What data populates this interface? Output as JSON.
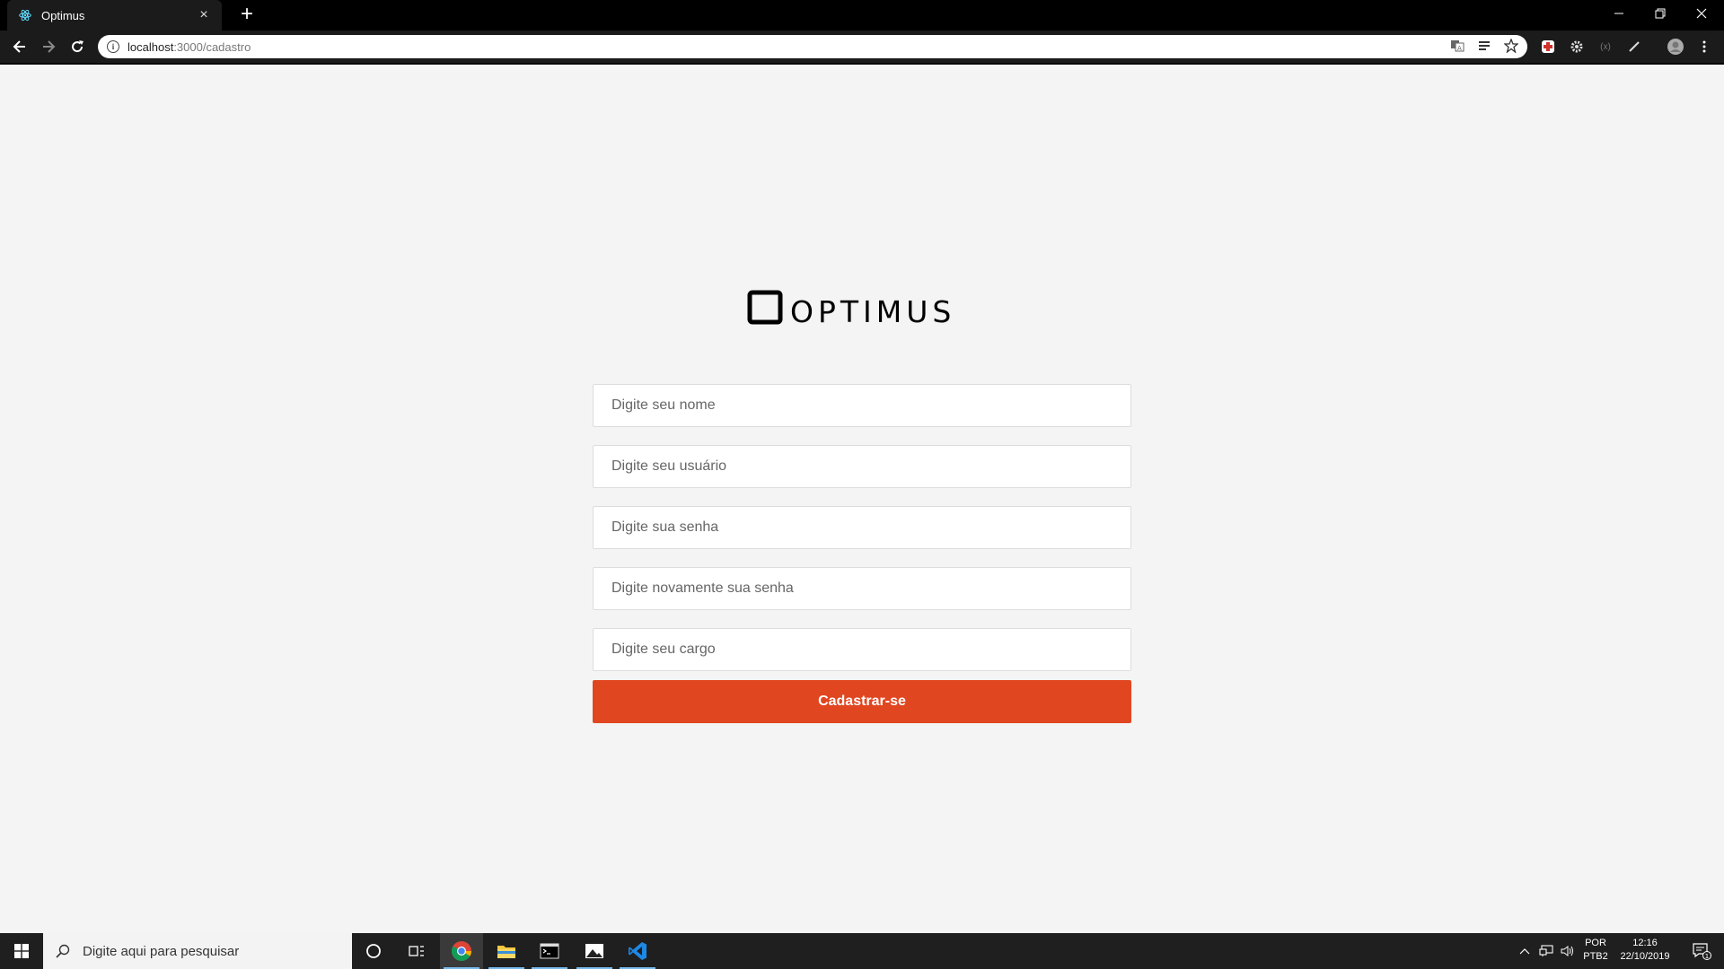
{
  "browser": {
    "tab_title": "Optimus",
    "tab_close": "×",
    "new_tab": "+",
    "url_host": "localhost",
    "url_path": ":3000/cadastro",
    "window_controls": {
      "minimize": "—",
      "restore": "❐",
      "close": "✕"
    }
  },
  "page": {
    "logo_text": "OPTIMUS",
    "form": {
      "name_placeholder": "Digite seu nome",
      "username_placeholder": "Digite seu usuário",
      "password_placeholder": "Digite sua senha",
      "password_confirm_placeholder": "Digite novamente sua senha",
      "role_placeholder": "Digite seu cargo",
      "submit_label": "Cadastrar-se"
    },
    "colors": {
      "accent": "#e04620",
      "background": "#f4f4f4"
    }
  },
  "taskbar": {
    "search_placeholder": "Digite aqui para pesquisar",
    "language_line1": "POR",
    "language_line2": "PTB2",
    "time": "12:16",
    "date": "22/10/2019",
    "notification_count": "1"
  }
}
